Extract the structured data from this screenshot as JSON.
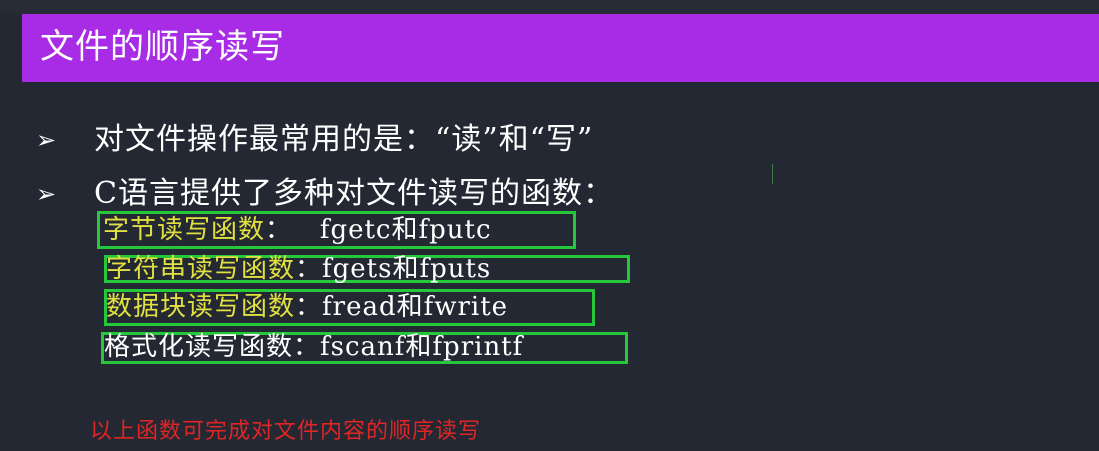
{
  "slide": {
    "title": "文件的顺序读写",
    "bullets": [
      {
        "marker": "➢",
        "text": "对文件操作最常用的是：“读”和“写”"
      },
      {
        "marker": "➢",
        "text": "C语言提供了多种对文件读写的函数："
      }
    ],
    "functions": [
      {
        "name": "字节读写函数",
        "colon": "：",
        "value": "   fgetc和fputc"
      },
      {
        "name": "字符串读写函数",
        "colon": "：",
        "value": "fgets和fputs"
      },
      {
        "name": "数据块读写函数",
        "colon": "：",
        "value": "fread和fwrite"
      },
      {
        "name": "格式化读写函数",
        "colon": "：",
        "value": "fscanf和fprintf"
      }
    ],
    "footer_note": "以上函数可完成对文件内容的顺序读写"
  },
  "colors": {
    "background": "#232833",
    "title_bar": "#a82ce6",
    "highlight_box": "#24c83a",
    "function_name": "#e0e040",
    "footer_note": "#e02525"
  }
}
